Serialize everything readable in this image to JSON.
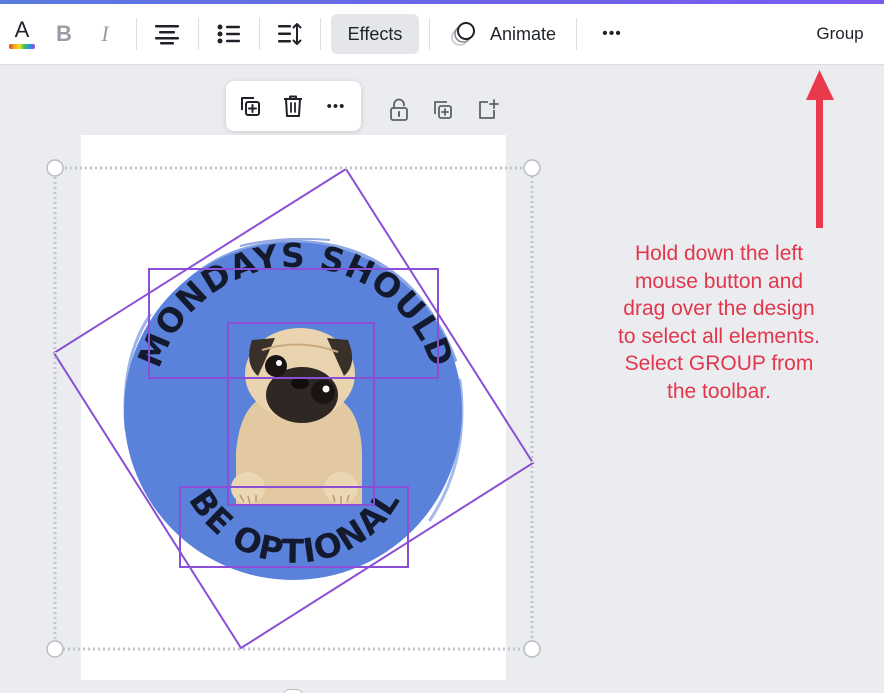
{
  "toolbar": {
    "text_color_letter": "A",
    "bold_letter": "B",
    "italic_letter": "I",
    "effects_label": "Effects",
    "animate_label": "Animate",
    "more_label": "•••",
    "group_label": "Group",
    "icons": [
      "text-color-icon",
      "bold-icon",
      "italic-icon",
      "align-center-icon",
      "list-icon",
      "spacing-icon",
      "animate-icon",
      "more-icon"
    ]
  },
  "floating_toolbar": {
    "more_label": "•••",
    "icons": [
      "duplicate-icon",
      "trash-icon",
      "more-icon"
    ]
  },
  "side_icons": [
    "lock-icon",
    "copy-icon",
    "add-page-icon"
  ],
  "design": {
    "top_text": "MONDAYS SHOULD",
    "bottom_text": "BE OPTIONAL"
  },
  "instructions": [
    "Hold down the left",
    "mouse button and",
    "drag over the design",
    "to select all elements.",
    "Select GROUP from",
    "the toolbar."
  ],
  "colors": {
    "accent_purple": "#8a4fd6",
    "instruction_red": "#e2364b",
    "circle_blue": "#5a82db",
    "toolbar_active": "#e5e6ea"
  }
}
